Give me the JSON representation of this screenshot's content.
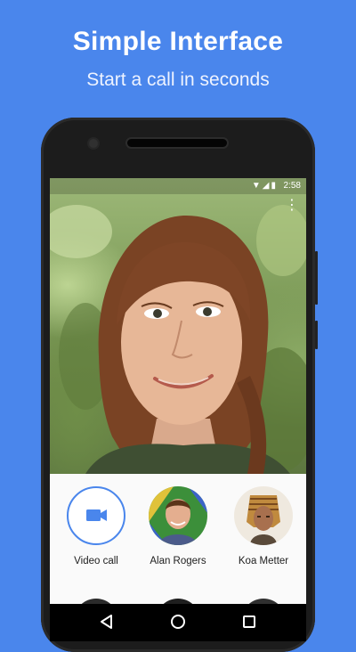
{
  "promo": {
    "title": "Simple Interface",
    "subtitle": "Start a call in seconds"
  },
  "status_bar": {
    "time": "2:58",
    "icons": [
      "wifi-icon",
      "cellular-icon",
      "battery-icon"
    ]
  },
  "video": {
    "menu_icon": "more-vert-icon"
  },
  "contacts": [
    {
      "label": "Video call",
      "icon": "videocam-icon"
    },
    {
      "label": "Alan Rogers",
      "icon": "avatar"
    },
    {
      "label": "Koa Metter",
      "icon": "avatar"
    }
  ],
  "nav_bar": {
    "back": "back-icon",
    "home": "home-icon",
    "recents": "recents-icon"
  },
  "colors": {
    "background": "#4a86ec",
    "accent": "#4a86ec"
  }
}
